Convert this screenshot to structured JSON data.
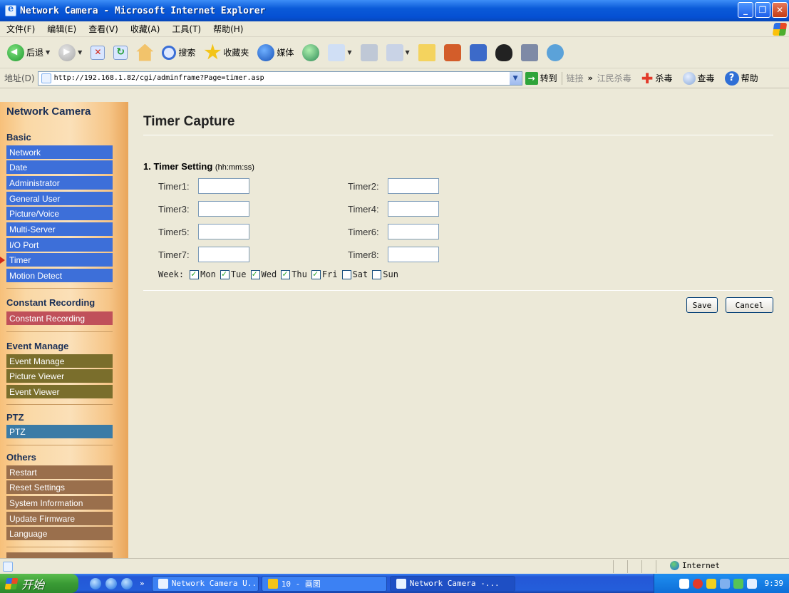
{
  "window": {
    "title": "Network Camera - Microsoft Internet Explorer"
  },
  "menu": [
    "文件(F)",
    "编辑(E)",
    "查看(V)",
    "收藏(A)",
    "工具(T)",
    "帮助(H)"
  ],
  "toolbar": {
    "back_label": "后退",
    "search_label": "搜索",
    "favorites_label": "收藏夹",
    "media_label": "媒体"
  },
  "address": {
    "label": "地址(D)",
    "url": "http://192.168.1.82/cgi/adminframe?Page=timer.asp",
    "go_label": "转到",
    "links_label": "链接",
    "ext_jiangmin": "江民杀毒",
    "ext_kill": "杀毒",
    "ext_scan": "查毒",
    "ext_help": "帮助"
  },
  "sidebar": {
    "title": "Network Camera",
    "sections": {
      "basic": "Basic",
      "constant": "Constant Recording",
      "event": "Event Manage",
      "ptz": "PTZ",
      "others": "Others"
    },
    "basic_items": [
      "Network",
      "Date",
      "Administrator",
      "General User",
      "Picture/Voice",
      "Multi-Server",
      "I/O Port",
      "Timer",
      "Motion Detect"
    ],
    "constant_items": [
      "Constant Recording"
    ],
    "event_items": [
      "Event Manage",
      "Picture Viewer",
      "Event Viewer"
    ],
    "ptz_items": [
      "PTZ"
    ],
    "others_items": [
      "Restart",
      "Reset Settings",
      "System Information",
      "Update Firmware",
      "Language"
    ]
  },
  "main": {
    "title": "Timer Capture",
    "section_title": "1. Timer Setting",
    "section_format": "(hh:mm:ss)",
    "timers": [
      "Timer1:",
      "Timer2:",
      "Timer3:",
      "Timer4:",
      "Timer5:",
      "Timer6:",
      "Timer7:",
      "Timer8:"
    ],
    "timer_values": [
      "",
      "",
      "",
      "",
      "",
      "",
      "",
      ""
    ],
    "week_label": "Week:",
    "days": [
      {
        "label": "Mon",
        "checked": true
      },
      {
        "label": "Tue",
        "checked": true
      },
      {
        "label": "Wed",
        "checked": true
      },
      {
        "label": "Thu",
        "checked": true
      },
      {
        "label": "Fri",
        "checked": true
      },
      {
        "label": "Sat",
        "checked": false
      },
      {
        "label": "Sun",
        "checked": false
      }
    ],
    "save_label": "Save",
    "cancel_label": "Cancel"
  },
  "status": {
    "zone": "Internet"
  },
  "taskbar": {
    "start_label": "开始",
    "tasks": [
      "Network Camera U...",
      "10 - 画图",
      "Network Camera -..."
    ],
    "clock": "9:39"
  }
}
